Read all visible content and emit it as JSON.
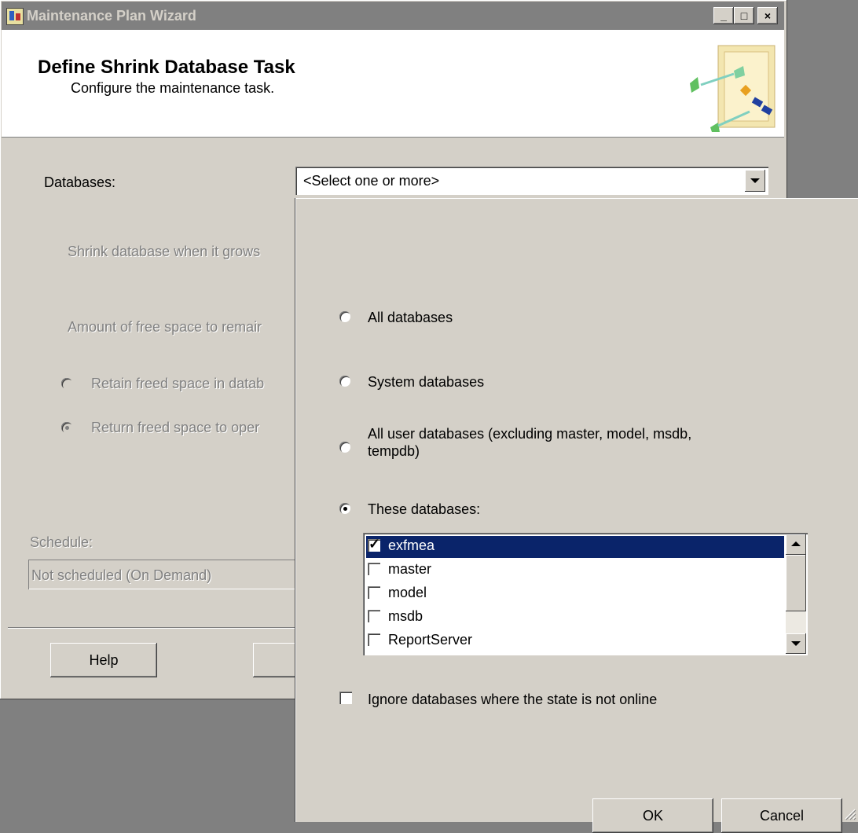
{
  "window": {
    "title": "Maintenance Plan Wizard",
    "minimize": "_",
    "maximize": "□",
    "close": "×"
  },
  "header": {
    "title": "Define Shrink Database Task",
    "subtitle": "Configure the maintenance task.",
    "graphic_icon": "wizard-diagram-icon"
  },
  "form": {
    "databases_label": "Databases:",
    "databases_value": "<Select one or more>",
    "shrink_label": "Shrink database when it grows",
    "amount_label": "Amount of free space to remair",
    "retain_label": "Retain freed space in datab",
    "return_label": "Return freed space to oper",
    "schedule_label": "Schedule:",
    "schedule_value": "Not scheduled (On Demand)"
  },
  "buttons": {
    "help": "Help",
    "back": "<"
  },
  "popup": {
    "all_databases": "All databases",
    "system_databases": "System databases",
    "all_user_databases_line1": "All user databases  (excluding master, model, msdb,",
    "all_user_databases_line2": "tempdb)",
    "these_databases": "These databases:",
    "selected_option": "These databases:",
    "databases": [
      {
        "name": "exfmea",
        "checked": true,
        "selected": true
      },
      {
        "name": "master",
        "checked": false,
        "selected": false
      },
      {
        "name": "model",
        "checked": false,
        "selected": false
      },
      {
        "name": "msdb",
        "checked": false,
        "selected": false
      },
      {
        "name": "ReportServer",
        "checked": false,
        "selected": false
      }
    ],
    "ignore_offline": "Ignore databases where the state is not online",
    "ok": "OK",
    "cancel": "Cancel"
  },
  "colors": {
    "face": "#d4d0c8",
    "selection": "#0a246a",
    "disabled_text": "#808080"
  }
}
